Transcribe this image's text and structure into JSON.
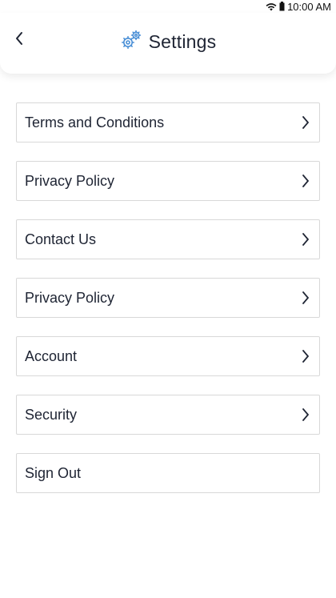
{
  "status_bar": {
    "time": "10:00 AM"
  },
  "header": {
    "title": "Settings",
    "back_icon": "chevron-left-icon",
    "title_icon": "gears-icon",
    "accent_color": "#4a8fd6"
  },
  "menu": {
    "items": [
      {
        "label": "Terms and Conditions",
        "chevron": true
      },
      {
        "label": "Privacy Policy",
        "chevron": true
      },
      {
        "label": "Contact Us",
        "chevron": true
      },
      {
        "label": "Privacy Policy",
        "chevron": true
      },
      {
        "label": "Account",
        "chevron": true
      },
      {
        "label": "Security",
        "chevron": true
      },
      {
        "label": "Sign Out",
        "chevron": false
      }
    ]
  }
}
